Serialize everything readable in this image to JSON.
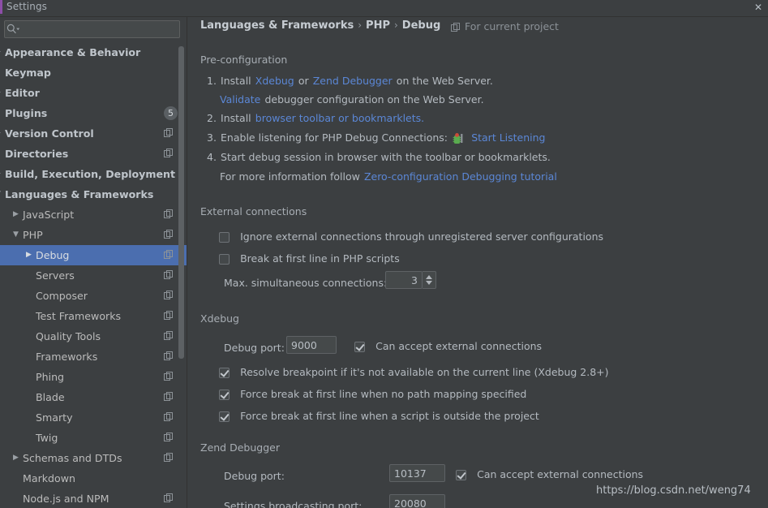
{
  "window": {
    "title": "Settings",
    "close_label": "✕",
    "accent_color": "#8d4ea8"
  },
  "search": {
    "value": "",
    "placeholder": "",
    "icon": "search-icon"
  },
  "sidebar": {
    "items": [
      {
        "label": "Appearance & Behavior",
        "indent": 6,
        "arrow": "▶",
        "bold": true,
        "project_icon": false,
        "badge": null,
        "selected": false
      },
      {
        "label": "Keymap",
        "indent": 6,
        "arrow": "",
        "bold": true,
        "project_icon": false,
        "badge": null,
        "selected": false
      },
      {
        "label": "Editor",
        "indent": 6,
        "arrow": "▶",
        "bold": true,
        "project_icon": false,
        "badge": null,
        "selected": false
      },
      {
        "label": "Plugins",
        "indent": 6,
        "arrow": "",
        "bold": true,
        "project_icon": false,
        "badge": "5",
        "selected": false
      },
      {
        "label": "Version Control",
        "indent": 6,
        "arrow": "▶",
        "bold": true,
        "project_icon": true,
        "badge": null,
        "selected": false
      },
      {
        "label": "Directories",
        "indent": 6,
        "arrow": "",
        "bold": true,
        "project_icon": true,
        "badge": null,
        "selected": false
      },
      {
        "label": "Build, Execution, Deployment",
        "indent": 6,
        "arrow": "▶",
        "bold": true,
        "project_icon": false,
        "badge": null,
        "selected": false
      },
      {
        "label": "Languages & Frameworks",
        "indent": 6,
        "arrow": "▼",
        "bold": true,
        "project_icon": false,
        "badge": null,
        "selected": false
      },
      {
        "label": "JavaScript",
        "indent": 28,
        "arrow": "▶",
        "bold": false,
        "project_icon": true,
        "badge": null,
        "selected": false
      },
      {
        "label": "PHP",
        "indent": 28,
        "arrow": "▼",
        "bold": false,
        "project_icon": true,
        "badge": null,
        "selected": false
      },
      {
        "label": "Debug",
        "indent": 44,
        "arrow": "▶",
        "bold": false,
        "project_icon": true,
        "badge": null,
        "selected": true
      },
      {
        "label": "Servers",
        "indent": 44,
        "arrow": "",
        "bold": false,
        "project_icon": true,
        "badge": null,
        "selected": false
      },
      {
        "label": "Composer",
        "indent": 44,
        "arrow": "",
        "bold": false,
        "project_icon": true,
        "badge": null,
        "selected": false
      },
      {
        "label": "Test Frameworks",
        "indent": 44,
        "arrow": "",
        "bold": false,
        "project_icon": true,
        "badge": null,
        "selected": false
      },
      {
        "label": "Quality Tools",
        "indent": 44,
        "arrow": "",
        "bold": false,
        "project_icon": true,
        "badge": null,
        "selected": false
      },
      {
        "label": "Frameworks",
        "indent": 44,
        "arrow": "",
        "bold": false,
        "project_icon": true,
        "badge": null,
        "selected": false
      },
      {
        "label": "Phing",
        "indent": 44,
        "arrow": "",
        "bold": false,
        "project_icon": true,
        "badge": null,
        "selected": false
      },
      {
        "label": "Blade",
        "indent": 44,
        "arrow": "",
        "bold": false,
        "project_icon": true,
        "badge": null,
        "selected": false
      },
      {
        "label": "Smarty",
        "indent": 44,
        "arrow": "",
        "bold": false,
        "project_icon": true,
        "badge": null,
        "selected": false
      },
      {
        "label": "Twig",
        "indent": 44,
        "arrow": "",
        "bold": false,
        "project_icon": true,
        "badge": null,
        "selected": false
      },
      {
        "label": "Schemas and DTDs",
        "indent": 28,
        "arrow": "▶",
        "bold": false,
        "project_icon": true,
        "badge": null,
        "selected": false
      },
      {
        "label": "Markdown",
        "indent": 28,
        "arrow": "",
        "bold": false,
        "project_icon": false,
        "badge": null,
        "selected": false
      },
      {
        "label": "Node.js and NPM",
        "indent": 28,
        "arrow": "",
        "bold": false,
        "project_icon": true,
        "badge": null,
        "selected": false
      }
    ]
  },
  "main": {
    "breadcrumb": {
      "part1": "Languages & Frameworks",
      "sep1": "›",
      "part2": "PHP",
      "sep2": "›",
      "part3": "Debug"
    },
    "scope_label": "For current project",
    "preconfiguration": {
      "title": "Pre-configuration",
      "step1_num": "1.",
      "step1_install": "Install",
      "step1_xdebug": "Xdebug",
      "step1_or": "or",
      "step1_zend": "Zend Debugger",
      "step1_tail": "on the Web Server.",
      "step1b_validate": "Validate",
      "step1b_tail": "debugger configuration on the Web Server.",
      "step2_num": "2.",
      "step2_install": "Install",
      "step2_link": "browser toolbar or bookmarklets.",
      "step3_num": "3.",
      "step3_text": "Enable listening for PHP Debug Connections:",
      "step3_link": "Start Listening",
      "step4_num": "4.",
      "step4_text": "Start debug session in browser with the toolbar or bookmarklets.",
      "step4b_text": "For more information follow",
      "step4b_link": "Zero-configuration Debugging tutorial"
    },
    "external_connections": {
      "title": "External connections",
      "ignore_label": "Ignore external connections through unregistered server configurations",
      "ignore_checked": false,
      "break_label": "Break at first line in PHP scripts",
      "break_checked": false,
      "max_conn_label": "Max. simultaneous connections:",
      "max_conn_value": "3"
    },
    "xdebug": {
      "title": "Xdebug",
      "port_label": "Debug port:",
      "port_value": "9000",
      "accept_label": "Can accept external connections",
      "accept_checked": true,
      "resolve_label": "Resolve breakpoint if it's not available on the current line (Xdebug 2.8+)",
      "resolve_checked": true,
      "force_nopath_label": "Force break at first line when no path mapping specified",
      "force_nopath_checked": true,
      "force_outside_label": "Force break at first line when a script is outside the project",
      "force_outside_checked": true
    },
    "zend": {
      "title": "Zend Debugger",
      "port_label": "Debug port:",
      "port_value": "10137",
      "accept_label": "Can accept external connections",
      "accept_checked": true,
      "broadcast_label": "Settings broadcasting port:",
      "broadcast_value": "20080"
    }
  },
  "watermark": "https://blog.csdn.net/weng74"
}
